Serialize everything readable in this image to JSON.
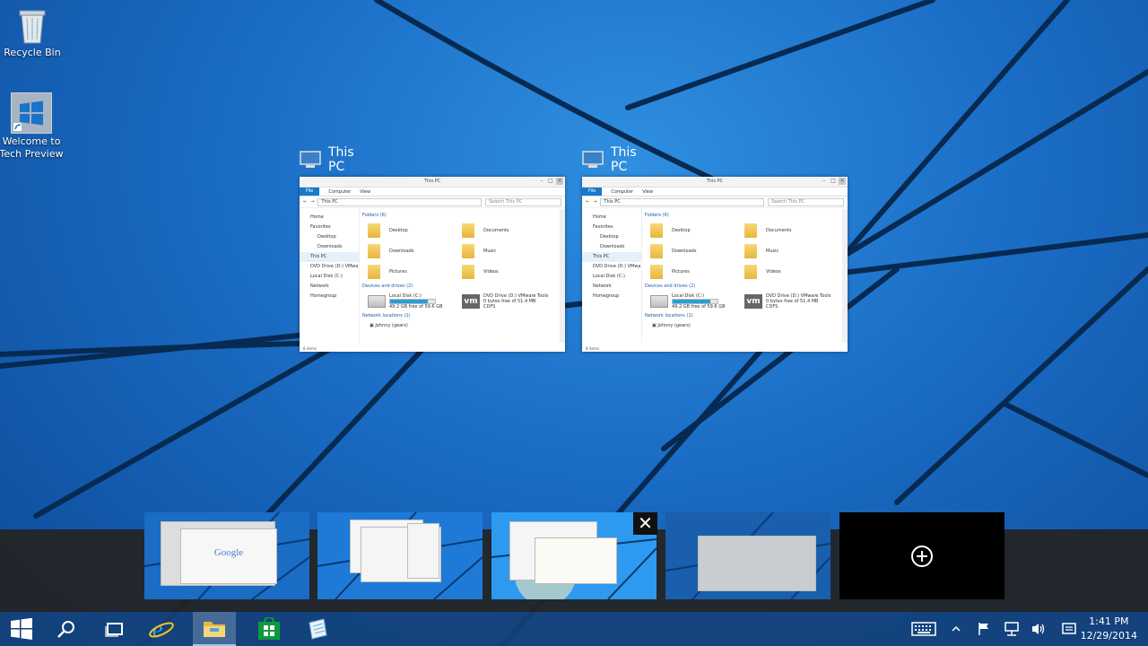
{
  "desktop": {
    "icons": [
      {
        "label": "Recycle Bin",
        "icon": "recycle-bin-icon"
      },
      {
        "label": "Welcome to Tech Preview",
        "icon": "windows-logo-icon"
      }
    ]
  },
  "task_view": {
    "windows": [
      {
        "caption": "This PC",
        "title_bar": "This PC",
        "tabs": [
          "File",
          "Computer",
          "View"
        ],
        "address": "This PC",
        "search_placeholder": "Search This PC",
        "nav": [
          "Home",
          "Favorites",
          "Desktop",
          "Downloads",
          "This PC",
          "DVD Drive (D:) VMwa",
          "Local Disk (C:)",
          "Network",
          "Homegroup"
        ],
        "groups": {
          "folders": "Folders (6)",
          "devices": "Devices and drives (2)",
          "network": "Network locations (1)"
        },
        "folders": [
          "Desktop",
          "Documents",
          "Downloads",
          "Music",
          "Pictures",
          "Videos"
        ],
        "drive_c": {
          "name": "Local Disk (C:)",
          "free": "49.2 GB free of 59.6 GB",
          "used_fraction": 0.17
        },
        "drive_d": {
          "name": "DVD Drive (D:) VMware Tools",
          "free": "0 bytes free of 51.4 MB",
          "fs": "CDFS",
          "badge": "vm"
        },
        "network_item": "Johnny (gears)",
        "status": "8 items"
      },
      {
        "caption": "This PC",
        "title_bar": "This PC",
        "tabs": [
          "File",
          "Computer",
          "View"
        ],
        "address": "This PC",
        "search_placeholder": "Search This PC",
        "nav": [
          "Home",
          "Favorites",
          "Desktop",
          "Downloads",
          "This PC",
          "DVD Drive (D:) VMwa",
          "Local Disk (C:)",
          "Network",
          "Homegroup"
        ],
        "groups": {
          "folders": "Folders (6)",
          "devices": "Devices and drives (2)",
          "network": "Network locations (1)"
        },
        "folders": [
          "Desktop",
          "Documents",
          "Downloads",
          "Music",
          "Pictures",
          "Videos"
        ],
        "drive_c": {
          "name": "Local Disk (C:)",
          "free": "49.2 GB free of 59.6 GB",
          "used_fraction": 0.17
        },
        "drive_d": {
          "name": "DVD Drive (D:) VMware Tools",
          "free": "0 bytes free of 51.4 MB",
          "fs": "CDFS",
          "badge": "vm"
        },
        "network_item": "Johnny (gears)",
        "status": "8 items"
      }
    ],
    "desktops": {
      "first_thumb_text": "Google",
      "close_symbol": "✕",
      "add_icon": "plus-circle-icon"
    }
  },
  "taskbar": {
    "buttons": [
      "start-icon",
      "search-icon",
      "task-view-icon",
      "internet-explorer-icon",
      "file-explorer-icon",
      "store-icon",
      "notepad-icon"
    ],
    "tray": [
      "keyboard-icon",
      "chevron-up-icon",
      "flag-icon",
      "network-icon",
      "volume-icon",
      "notification-icon"
    ],
    "clock": {
      "time": "1:41 PM",
      "date": "12/29/2014"
    }
  },
  "colors": {
    "accent": "#1979ca",
    "taskbar": "#144078",
    "desktop": "#1a6cc4"
  }
}
